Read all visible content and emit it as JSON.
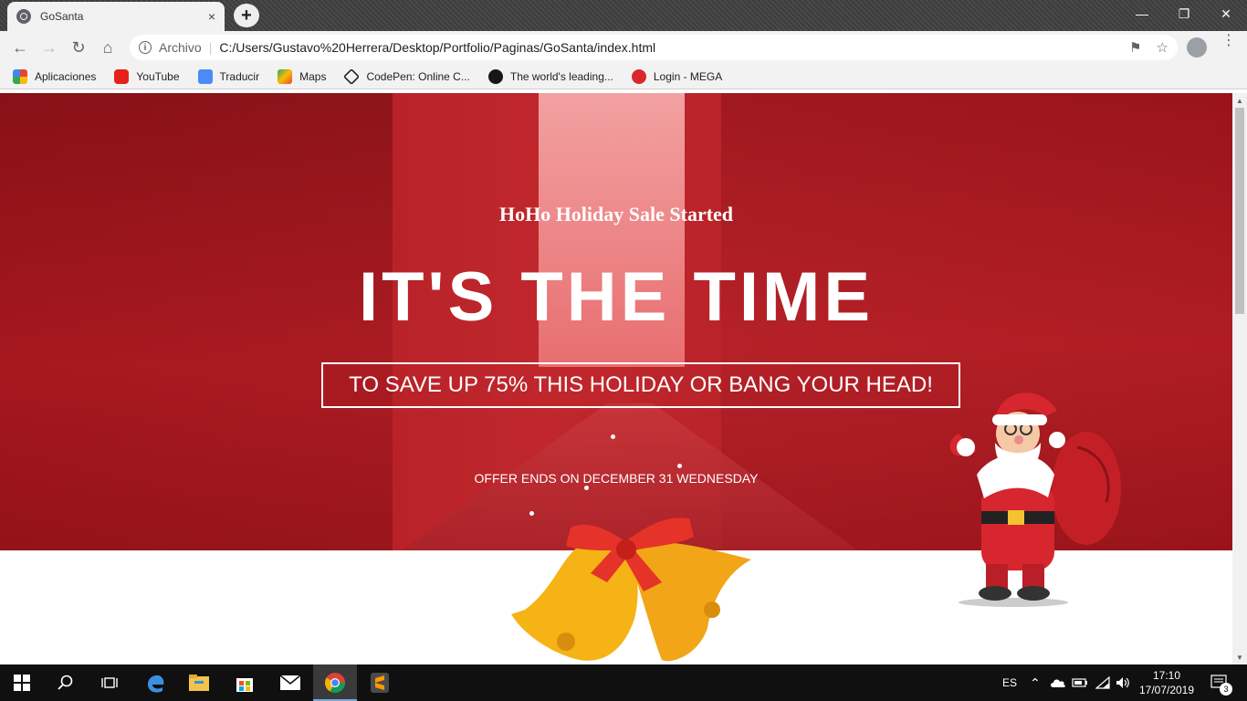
{
  "browser": {
    "tab_title": "GoSanta",
    "tab_close": "×",
    "new_tab": "+",
    "scheme_label": "Archivo",
    "url": "C:/Users/Gustavo%20Herrera/Desktop/Portfolio/Paginas/GoSanta/index.html",
    "bookmarks": [
      {
        "label": "Aplicaciones",
        "color": "#e8453c"
      },
      {
        "label": "YouTube",
        "color": "#e62117"
      },
      {
        "label": "Traducir",
        "color": "#4c8bf5"
      },
      {
        "label": "Maps",
        "color": "#34a853"
      },
      {
        "label": "CodePen: Online C...",
        "color": "#222222"
      },
      {
        "label": "The world's leading...",
        "color": "#181717"
      },
      {
        "label": "Login - MEGA",
        "color": "#d9272e"
      }
    ]
  },
  "hero": {
    "subtitle": "HoHo Holiday Sale Started",
    "title": "IT'S THE TIME",
    "box_text": "TO SAVE UP 75% THIS HOLIDAY OR BANG YOUR HEAD!",
    "offer": "OFFER ENDS ON DECEMBER 31 WEDNESDAY",
    "accent_color": "#c0272d"
  },
  "taskbar": {
    "language": "ES",
    "time": "17:10",
    "date": "17/07/2019",
    "notifications": "3"
  }
}
